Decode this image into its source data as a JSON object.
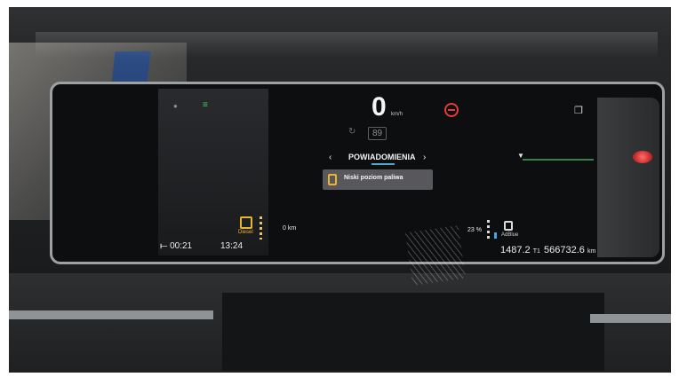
{
  "cluster": {
    "left": {
      "trip_time": "⟝ 00:21",
      "clock": "13:24",
      "fuel_label": "Diesel"
    },
    "center": {
      "speed": "0",
      "speed_unit": "km/h",
      "speed_limit": "89",
      "nav_prev": "‹",
      "nav_title": "POWIADOMIENIA",
      "nav_next": "›",
      "notice_text": "Niski poziom paliwa",
      "range_left": "0 km",
      "adblue_percent": "23 %",
      "adblue_label": "AdBlue"
    },
    "right": {
      "trip_km_value": "1487.2",
      "trip_km_unit": "T1",
      "total_km_value": "566732.6",
      "total_km_unit": "km"
    }
  },
  "icons": [
    "high-beam-icon",
    "fuel-pump-icon",
    "no-entry-icon",
    "adblue-icon",
    "window-icon",
    "warning-lamp-icon"
  ],
  "colors": {
    "warning_amber": "#e8b52d",
    "beam_green": "#3ecf5a",
    "alert_red": "#e33b3b",
    "adblue_blue": "#49a4e0"
  }
}
